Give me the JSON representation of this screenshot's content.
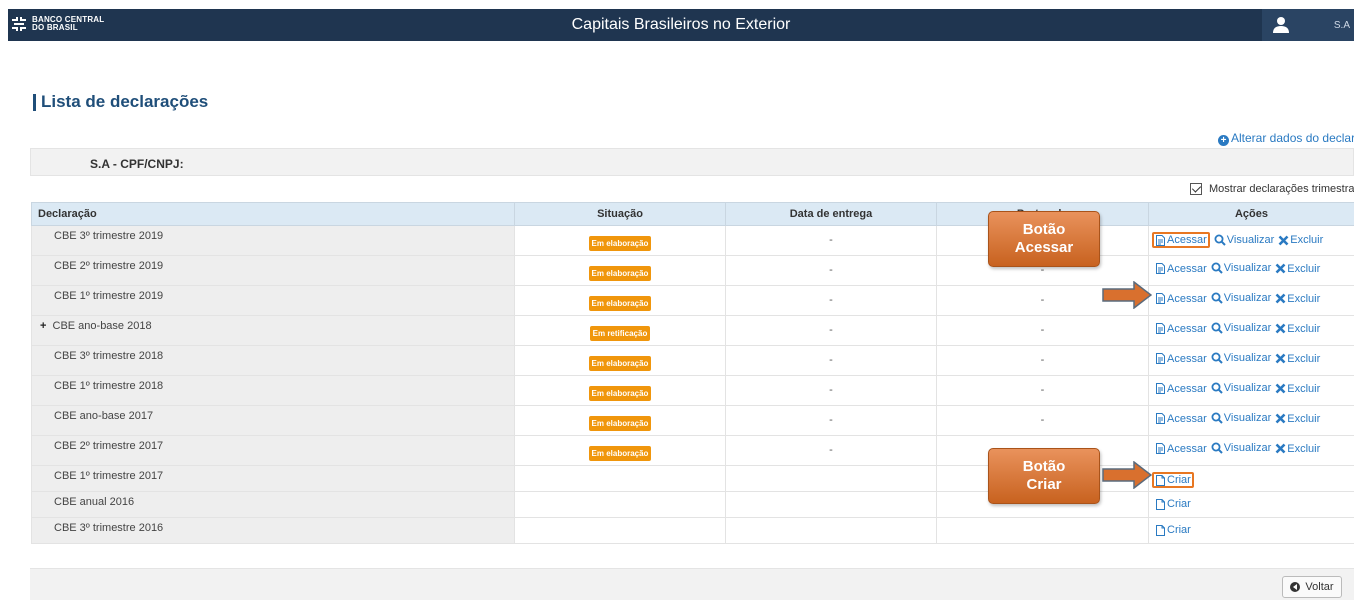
{
  "header": {
    "logo_line1": "BANCO CENTRAL",
    "logo_line2": "DO BRASIL",
    "app_title": "Capitais Brasileiros no Exterior",
    "user_name": "S.A"
  },
  "page": {
    "title": "Lista de declarações",
    "alter_link": "Alterar dados do declarante",
    "declarant": "S.A - CPF/CNPJ:",
    "show_quarterly": "Mostrar declarações trimestrais",
    "back_button": "Voltar"
  },
  "table": {
    "columns": [
      "Declaração",
      "Situação",
      "Data de entrega",
      "Protocolo",
      "Ações"
    ],
    "actions": {
      "access": "Acessar",
      "view": "Visualizar",
      "delete": "Excluir",
      "create": "Criar"
    },
    "rows": [
      {
        "name": "CBE 3º trimestre 2019",
        "status": "Em elaboração",
        "date": "-",
        "protocol": "-"
      },
      {
        "name": "CBE 2º trimestre 2019",
        "status": "Em elaboração",
        "date": "-",
        "protocol": "-"
      },
      {
        "name": "CBE 1º trimestre 2019",
        "status": "Em elaboração",
        "date": "-",
        "protocol": "-"
      },
      {
        "name": "CBE ano-base 2018",
        "status": "Em retificação",
        "date": "-",
        "protocol": "-"
      },
      {
        "name": "CBE 3º trimestre 2018",
        "status": "Em elaboração",
        "date": "-",
        "protocol": "-"
      },
      {
        "name": "CBE 1º trimestre 2018",
        "status": "Em elaboração",
        "date": "-",
        "protocol": "-"
      },
      {
        "name": "CBE ano-base 2017",
        "status": "Em elaboração",
        "date": "-",
        "protocol": "-"
      },
      {
        "name": "CBE 2º trimestre 2017",
        "status": "Em elaboração",
        "date": "-",
        "protocol": "-"
      },
      {
        "name": "CBE 1º trimestre 2017"
      },
      {
        "name": "CBE anual 2016"
      },
      {
        "name": "CBE 3º trimestre 2016"
      }
    ]
  },
  "callouts": {
    "access": [
      "Botão",
      "Acessar"
    ],
    "create": [
      "Botão",
      "Criar"
    ]
  },
  "colors": {
    "header_bg": "#1f3550",
    "title": "#1f4e79",
    "link": "#2a7ac2",
    "badge": "#f0960c",
    "callout": "#d9702e",
    "table_header": "#dbe9f4"
  }
}
